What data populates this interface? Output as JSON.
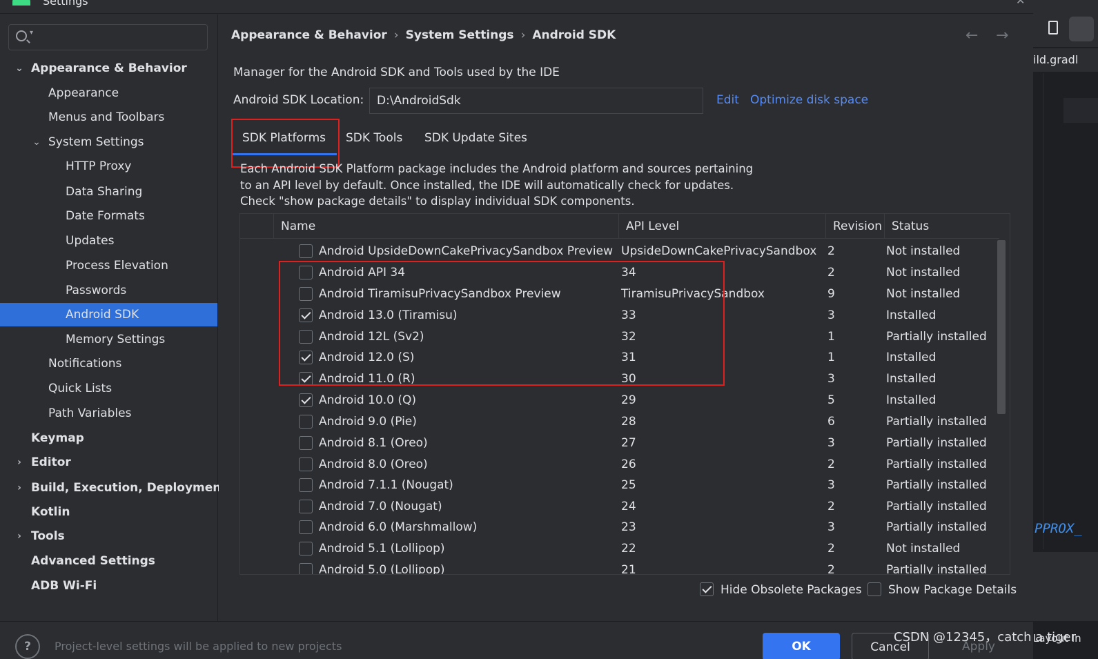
{
  "window": {
    "title": "Settings"
  },
  "search": {
    "placeholder": ""
  },
  "sidebar": {
    "items": [
      {
        "label": "Appearance & Behavior",
        "level": 0,
        "bold": true,
        "arrow": "expanded"
      },
      {
        "label": "Appearance",
        "level": 1
      },
      {
        "label": "Menus and Toolbars",
        "level": 1
      },
      {
        "label": "System Settings",
        "level": 1,
        "arrow": "expanded"
      },
      {
        "label": "HTTP Proxy",
        "level": 2
      },
      {
        "label": "Data Sharing",
        "level": 2
      },
      {
        "label": "Date Formats",
        "level": 2
      },
      {
        "label": "Updates",
        "level": 2
      },
      {
        "label": "Process Elevation",
        "level": 2
      },
      {
        "label": "Passwords",
        "level": 2
      },
      {
        "label": "Android SDK",
        "level": 2,
        "selected": true
      },
      {
        "label": "Memory Settings",
        "level": 2
      },
      {
        "label": "Notifications",
        "level": 1
      },
      {
        "label": "Quick Lists",
        "level": 1
      },
      {
        "label": "Path Variables",
        "level": 1
      },
      {
        "label": "Keymap",
        "level": 0,
        "bold": true
      },
      {
        "label": "Editor",
        "level": 0,
        "bold": true,
        "arrow": "collapsed"
      },
      {
        "label": "Build, Execution, Deployment",
        "level": 0,
        "bold": true,
        "arrow": "collapsed"
      },
      {
        "label": "Kotlin",
        "level": 0,
        "bold": true
      },
      {
        "label": "Tools",
        "level": 0,
        "bold": true,
        "arrow": "collapsed"
      },
      {
        "label": "Advanced Settings",
        "level": 0,
        "bold": true
      },
      {
        "label": "ADB Wi-Fi",
        "level": 0,
        "bold": true
      }
    ]
  },
  "breadcrumb": [
    "Appearance & Behavior",
    "System Settings",
    "Android SDK"
  ],
  "nav": {
    "back": "←",
    "forward": "→"
  },
  "main": {
    "description": "Manager for the Android SDK and Tools used by the IDE",
    "location_label": "Android SDK Location:",
    "location_value": "D:\\AndroidSdk",
    "edit_link": "Edit",
    "optimize_link": "Optimize disk space",
    "tabs": [
      {
        "label": "SDK Platforms",
        "active": true
      },
      {
        "label": "SDK Tools",
        "active": false
      },
      {
        "label": "SDK Update Sites",
        "active": false
      }
    ],
    "tab_description": [
      "Each Android SDK Platform package includes the Android platform and sources pertaining",
      "to an API level by default. Once installed, the IDE will automatically check for updates.",
      "Check \"show package details\" to display individual SDK components."
    ]
  },
  "table": {
    "columns": [
      "Name",
      "API Level",
      "Revision",
      "Status"
    ],
    "rows": [
      {
        "checked": false,
        "name": "Android UpsideDownCakePrivacySandbox Preview",
        "api": "UpsideDownCakePrivacySandbox",
        "revision": "2",
        "status": "Not installed"
      },
      {
        "checked": false,
        "name": "Android API 34",
        "api": "34",
        "revision": "2",
        "status": "Not installed"
      },
      {
        "checked": false,
        "name": "Android TiramisuPrivacySandbox Preview",
        "api": "TiramisuPrivacySandbox",
        "revision": "9",
        "status": "Not installed"
      },
      {
        "checked": true,
        "name": "Android 13.0 (Tiramisu)",
        "api": "33",
        "revision": "3",
        "status": "Installed"
      },
      {
        "checked": false,
        "name": "Android 12L (Sv2)",
        "api": "32",
        "revision": "1",
        "status": "Partially installed"
      },
      {
        "checked": true,
        "name": "Android 12.0 (S)",
        "api": "31",
        "revision": "1",
        "status": "Installed"
      },
      {
        "checked": true,
        "name": "Android 11.0 (R)",
        "api": "30",
        "revision": "3",
        "status": "Installed"
      },
      {
        "checked": true,
        "name": "Android 10.0 (Q)",
        "api": "29",
        "revision": "5",
        "status": "Installed"
      },
      {
        "checked": false,
        "name": "Android 9.0 (Pie)",
        "api": "28",
        "revision": "6",
        "status": "Partially installed"
      },
      {
        "checked": false,
        "name": "Android 8.1 (Oreo)",
        "api": "27",
        "revision": "3",
        "status": "Partially installed"
      },
      {
        "checked": false,
        "name": "Android 8.0 (Oreo)",
        "api": "26",
        "revision": "2",
        "status": "Partially installed"
      },
      {
        "checked": false,
        "name": "Android 7.1.1 (Nougat)",
        "api": "25",
        "revision": "3",
        "status": "Partially installed"
      },
      {
        "checked": false,
        "name": "Android 7.0 (Nougat)",
        "api": "24",
        "revision": "2",
        "status": "Partially installed"
      },
      {
        "checked": false,
        "name": "Android 6.0 (Marshmallow)",
        "api": "23",
        "revision": "3",
        "status": "Partially installed"
      },
      {
        "checked": false,
        "name": "Android 5.1 (Lollipop)",
        "api": "22",
        "revision": "2",
        "status": "Not installed"
      },
      {
        "checked": false,
        "name": "Android 5.0 (Lollipop)",
        "api": "21",
        "revision": "2",
        "status": "Partially installed"
      }
    ]
  },
  "options": {
    "hide_obsolete": {
      "label": "Hide Obsolete Packages",
      "checked": true
    },
    "show_details": {
      "label": "Show Package Details",
      "checked": false
    }
  },
  "footer": {
    "help": "?",
    "note": "Project-level settings will be applied to new projects",
    "ok": "OK",
    "cancel": "Cancel",
    "apply": "Apply"
  },
  "watermark": "CSDN @12345，catch a tiger",
  "ide": {
    "tab": "ild.gradl",
    "code": "PPROX_",
    "layout": "Layout In"
  },
  "colors": {
    "background": "#2b2d30",
    "selection": "#2e6fd9",
    "accent": "#3574f0",
    "link": "#548af7",
    "annotation": "#e0201e"
  }
}
